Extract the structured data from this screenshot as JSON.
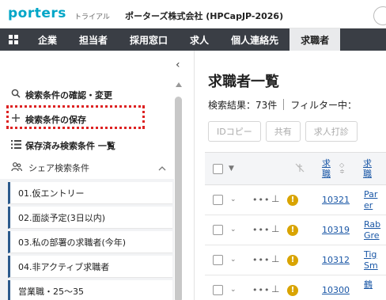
{
  "topbar": {
    "logo": "porters",
    "trial": "トライアル",
    "company": "ポーターズ株式会社 (HPCapJP-2026)"
  },
  "nav": {
    "items": [
      "企業",
      "担当者",
      "採用窓口",
      "求人",
      "個人連絡先",
      "求職者"
    ],
    "active": "求職者"
  },
  "sidebar": {
    "collapse_icon": "‹",
    "links": [
      {
        "icon": "search-icon",
        "label": "検索条件の確認・変更"
      },
      {
        "icon": "plus-icon",
        "label": "検索条件の保存"
      },
      {
        "icon": "list-icon",
        "label": "保存済み検索条件 一覧"
      }
    ],
    "shared_label": "シェア検索条件",
    "saved_items": [
      "01.仮エントリー",
      "02.面談予定(3日以内)",
      "03.私の部署の求職者(今年)",
      "04.非アクティブ求職者",
      "営業職・25〜35"
    ]
  },
  "main": {
    "title": "求職者一覧",
    "results_label": "検索結果：73件",
    "filter_label": "フィルター中：",
    "actions": [
      "IDコピー",
      "共有",
      "求人打診"
    ],
    "table": {
      "col_id_header": "求職",
      "col_name_header": "求職",
      "rows": [
        {
          "id": "10321",
          "name1": "Par",
          "name2": "er"
        },
        {
          "id": "10319",
          "name1": "Rab",
          "name2": "Gre"
        },
        {
          "id": "10312",
          "name1": "Tig",
          "name2": "Sm"
        },
        {
          "id": "10300",
          "name1": "鶴",
          "name2": ""
        }
      ]
    }
  },
  "colors": {
    "nav_bg": "#3a3e45",
    "brand": "#00a6c7",
    "link": "#1a57a6",
    "highlight_box": "#d22222",
    "warning": "#d9a400"
  }
}
